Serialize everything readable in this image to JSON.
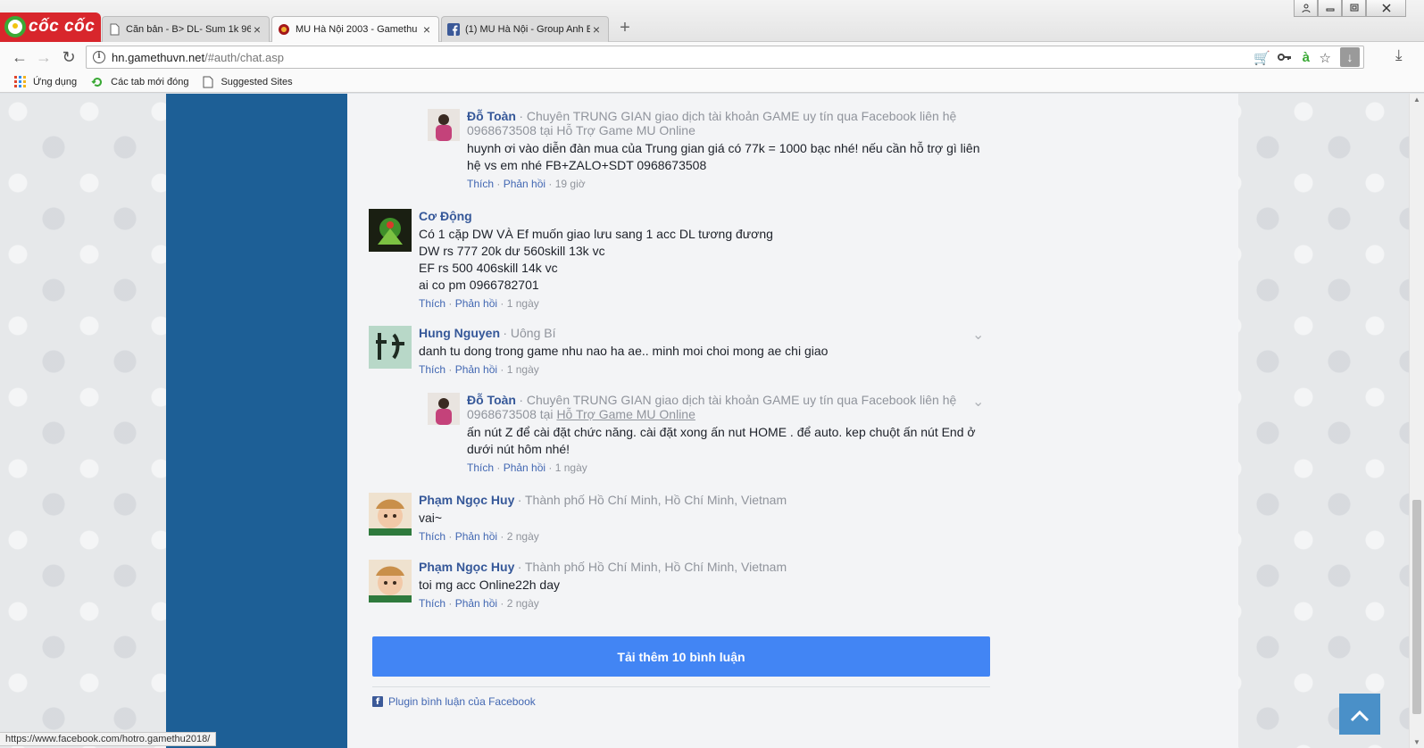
{
  "browser": {
    "logo_text": "cốc cốc",
    "tabs": [
      {
        "label": "Căn bản - B> DL- Sum 1k 96",
        "icon": "document-icon",
        "active": false
      },
      {
        "label": "MU Hà Nội 2003 - Gamethu",
        "icon": "mu-game-icon",
        "active": true
      },
      {
        "label": "(1) MU Hà Nội - Group Anh E",
        "icon": "facebook-icon",
        "active": false
      }
    ],
    "url_host": "hn.gamethuvn.net",
    "url_path": "/#auth/chat.asp",
    "bookmarks": [
      {
        "label": "Ứng dụng",
        "icon": "apps-grid-icon"
      },
      {
        "label": "Các tab mới đóng",
        "icon": "recent-tabs-icon"
      },
      {
        "label": "Suggested Sites",
        "icon": "document-icon"
      }
    ],
    "status_url": "https://www.facebook.com/hotro.gamethu2018/"
  },
  "comments": {
    "items": [
      {
        "name": "Đỗ Toàn",
        "meta": "· Chuyên TRUNG GIAN giao dịch tài khoản GAME uy tín qua Facebook liên hệ 0968673508 tại Hỗ Trợ Game MU Online",
        "text": "huynh ơi vào diễn đàn mua của Trung gian giá có 77k = 1000 bạc nhé! nếu cần hỗ trợ gì liên hệ vs em nhé FB+ZALO+SDT 0968673508",
        "like": "Thích",
        "reply": "Phản hồi",
        "time": "19 giờ"
      },
      {
        "name": "Cơ Động",
        "text_lines": [
          "Có 1 cặp DW VÀ Ef muốn giao lưu sang 1 acc DL tương đương",
          "DW rs 777 20k dư 560skill 13k vc",
          "EF rs 500 406skill 14k vc",
          "ai co pm 0966782701"
        ],
        "like": "Thích",
        "reply": "Phản hồi",
        "time": "1 ngày"
      },
      {
        "name": "Hung Nguyen",
        "meta": "· Uông Bí",
        "text": "danh tu dong trong game nhu nao ha ae.. minh moi choi mong ae chi giao",
        "like": "Thích",
        "reply": "Phản hồi",
        "time": "1 ngày"
      },
      {
        "name": "Đỗ Toàn",
        "meta_prefix": "· Chuyên TRUNG GIAN giao dịch tài khoản GAME uy tín qua Facebook liên hệ 0968673508 tại ",
        "meta_link": "Hỗ Trợ Game MU Online",
        "text": "ấn nút Z để cài đặt chức năng. cài đặt xong ấn nut HOME . để auto. kep chuột ấn nút End ở dưới nút hôm nhé!",
        "like": "Thích",
        "reply": "Phản hồi",
        "time": "1 ngày"
      },
      {
        "name": "Phạm Ngọc Huy",
        "meta": "· Thành phố Hồ Chí Minh, Hồ Chí Minh, Vietnam",
        "text": "vai~",
        "like": "Thích",
        "reply": "Phản hồi",
        "time": "2 ngày"
      },
      {
        "name": "Phạm Ngọc Huy",
        "meta": "· Thành phố Hồ Chí Minh, Hồ Chí Minh, Vietnam",
        "text": "toi mg acc Online22h day",
        "like": "Thích",
        "reply": "Phản hồi",
        "time": "2 ngày"
      }
    ],
    "load_more": "Tải thêm 10 bình luận",
    "plugin_label": "Plugin bình luận của Facebook"
  },
  "colors": {
    "sidebar": "#1d5f96",
    "load_more": "#4285f4",
    "name_link": "#365899",
    "scroll_top": "#4a90c8"
  }
}
